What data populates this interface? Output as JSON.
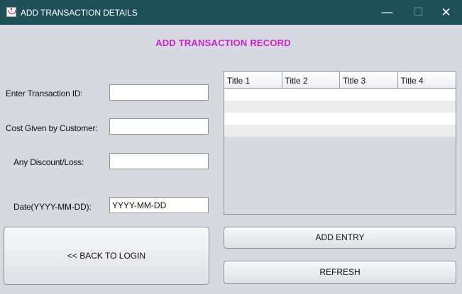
{
  "window": {
    "title": "ADD TRANSACTION DETAILS",
    "controls": {
      "minimize": "—",
      "maximize": "☐",
      "close": "✕"
    },
    "icon": "java-cup-icon"
  },
  "header": {
    "title": "ADD TRANSACTION RECORD",
    "color": "#cc22cc"
  },
  "form": {
    "transaction_id": {
      "label": "Enter Transaction ID:",
      "value": ""
    },
    "cost": {
      "label": "Cost Given by Customer:",
      "value": ""
    },
    "discount": {
      "label": "Any Discount/Loss:",
      "value": ""
    },
    "date": {
      "label": "Date(YYYY-MM-DD):",
      "value": "YYYY-MM-DD"
    }
  },
  "table": {
    "columns": [
      "Title 1",
      "Title 2",
      "Title 3",
      "Title 4"
    ],
    "rows": [
      [
        "",
        "",
        "",
        ""
      ],
      [
        "",
        "",
        "",
        ""
      ],
      [
        "",
        "",
        "",
        ""
      ],
      [
        "",
        "",
        "",
        ""
      ]
    ]
  },
  "buttons": {
    "back": "<< BACK TO LOGIN",
    "add": "ADD ENTRY",
    "refresh": "REFRESH"
  },
  "colors": {
    "titlebar": "#1e5058",
    "background": "#d6d9df"
  }
}
